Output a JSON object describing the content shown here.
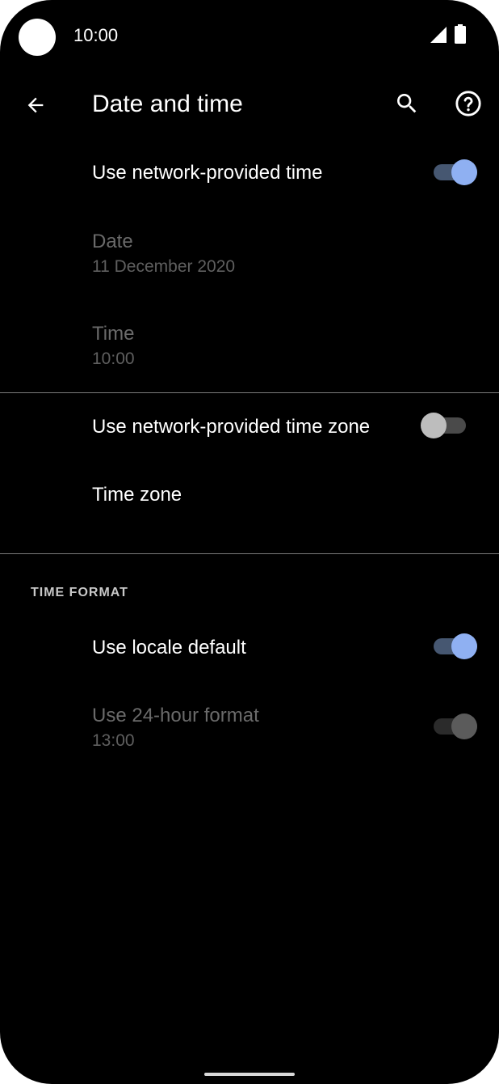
{
  "status_bar": {
    "time": "10:00",
    "icons": [
      "camera-cutout",
      "signal-icon",
      "battery-icon"
    ]
  },
  "app_bar": {
    "title": "Date and time",
    "icons": [
      "back-arrow-icon",
      "search-icon",
      "help-icon"
    ]
  },
  "settings": {
    "network_time": {
      "title": "Use network-provided time",
      "enabled": true
    },
    "date": {
      "title": "Date",
      "summary": "11 December 2020"
    },
    "time": {
      "title": "Time",
      "summary": "10:00"
    },
    "network_time_zone": {
      "title": "Use network-provided time zone",
      "enabled": false
    },
    "time_zone": {
      "title": "Time zone"
    },
    "time_format_header": "TIME FORMAT",
    "locale_default": {
      "title": "Use locale default",
      "enabled": true
    },
    "hour_format_24": {
      "title": "Use 24-hour format",
      "summary": "13:00",
      "enabled": true
    }
  },
  "colors": {
    "background": "#000000",
    "accent": "#8fb0f2",
    "accent_track": "#465771",
    "text_primary": "#ffffff",
    "text_disabled": "#6a6a6a",
    "divider": "#7a7a7a"
  }
}
